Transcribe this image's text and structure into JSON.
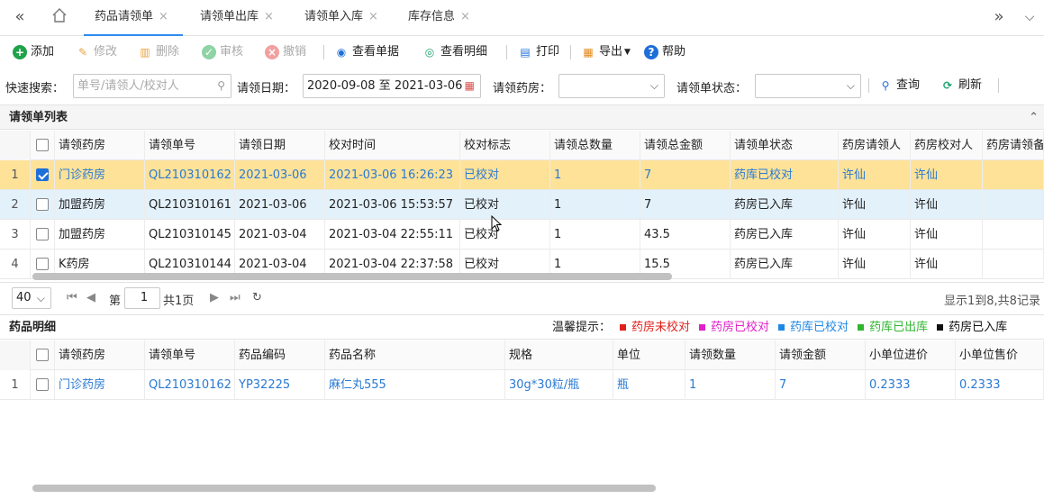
{
  "tabs": [
    {
      "label": "药品请领单",
      "active": true
    },
    {
      "label": "请领单出库",
      "active": false
    },
    {
      "label": "请领单入库",
      "active": false
    },
    {
      "label": "库存信息",
      "active": false
    }
  ],
  "toolbar": {
    "add": "添加",
    "edit": "修改",
    "delete": "删除",
    "audit": "审核",
    "revoke": "撤销",
    "view_doc": "查看单据",
    "view_detail": "查看明细",
    "print": "打印",
    "export": "导出",
    "help": "帮助"
  },
  "search": {
    "quick_label": "快速搜索：",
    "quick_placeholder": "单号/请领人/校对人",
    "date_label": "请领日期：",
    "date_value": "2020-09-08 至 2021-03-06",
    "pharmacy_label": "请领药房：",
    "status_label": "请领单状态：",
    "query": "查询",
    "refresh": "刷新"
  },
  "list_panel": {
    "title": "请领单列表",
    "columns": [
      "请领药房",
      "请领单号",
      "请领日期",
      "校对时间",
      "校对标志",
      "请领总数量",
      "请领总金额",
      "请领单状态",
      "药房请领人",
      "药房校对人",
      "药房请领备注"
    ],
    "rows": [
      {
        "num": "1",
        "checked": true,
        "cells": [
          "门诊药房",
          "QL210310162",
          "2021-03-06",
          "2021-03-06 16:26:23",
          "已校对",
          "1",
          "7",
          "药库已校对",
          "许仙",
          "许仙",
          ""
        ]
      },
      {
        "num": "2",
        "checked": false,
        "cells": [
          "加盟药房",
          "QL210310161",
          "2021-03-06",
          "2021-03-06 15:53:57",
          "已校对",
          "1",
          "7",
          "药房已入库",
          "许仙",
          "许仙",
          ""
        ]
      },
      {
        "num": "3",
        "checked": false,
        "cells": [
          "加盟药房",
          "QL210310145",
          "2021-03-04",
          "2021-03-04 22:55:11",
          "已校对",
          "1",
          "43.5",
          "药房已入库",
          "许仙",
          "许仙",
          ""
        ]
      },
      {
        "num": "4",
        "checked": false,
        "cells": [
          "K药房",
          "QL210310144",
          "2021-03-04",
          "2021-03-04 22:37:58",
          "已校对",
          "1",
          "15.5",
          "药房已入库",
          "许仙",
          "许仙",
          ""
        ]
      }
    ]
  },
  "pager": {
    "page_size": "40",
    "page_prefix": "第",
    "page_value": "1",
    "page_total": "共1页",
    "summary": "显示1到8,共8记录"
  },
  "detail_panel": {
    "title": "药品明细",
    "hint_label": "温馨提示：",
    "legend": [
      {
        "label": "药房未校对",
        "color": "#e0201c"
      },
      {
        "label": "药房已校对",
        "color": "#e020c8"
      },
      {
        "label": "药库已校对",
        "color": "#1e88e5"
      },
      {
        "label": "药库已出库",
        "color": "#2fb52f"
      },
      {
        "label": "药房已入库",
        "color": "#111111"
      }
    ],
    "columns": [
      "请领药房",
      "请领单号",
      "药品编码",
      "药品名称",
      "规格",
      "单位",
      "请领数量",
      "请领金额",
      "小单位进价",
      "小单位售价"
    ],
    "rows": [
      {
        "num": "1",
        "checked": false,
        "cells": [
          "门诊药房",
          "QL210310162",
          "YP32225",
          "麻仁丸555",
          "30g*30粒/瓶",
          "瓶",
          "1",
          "7",
          "0.2333",
          "0.2333"
        ]
      }
    ]
  }
}
